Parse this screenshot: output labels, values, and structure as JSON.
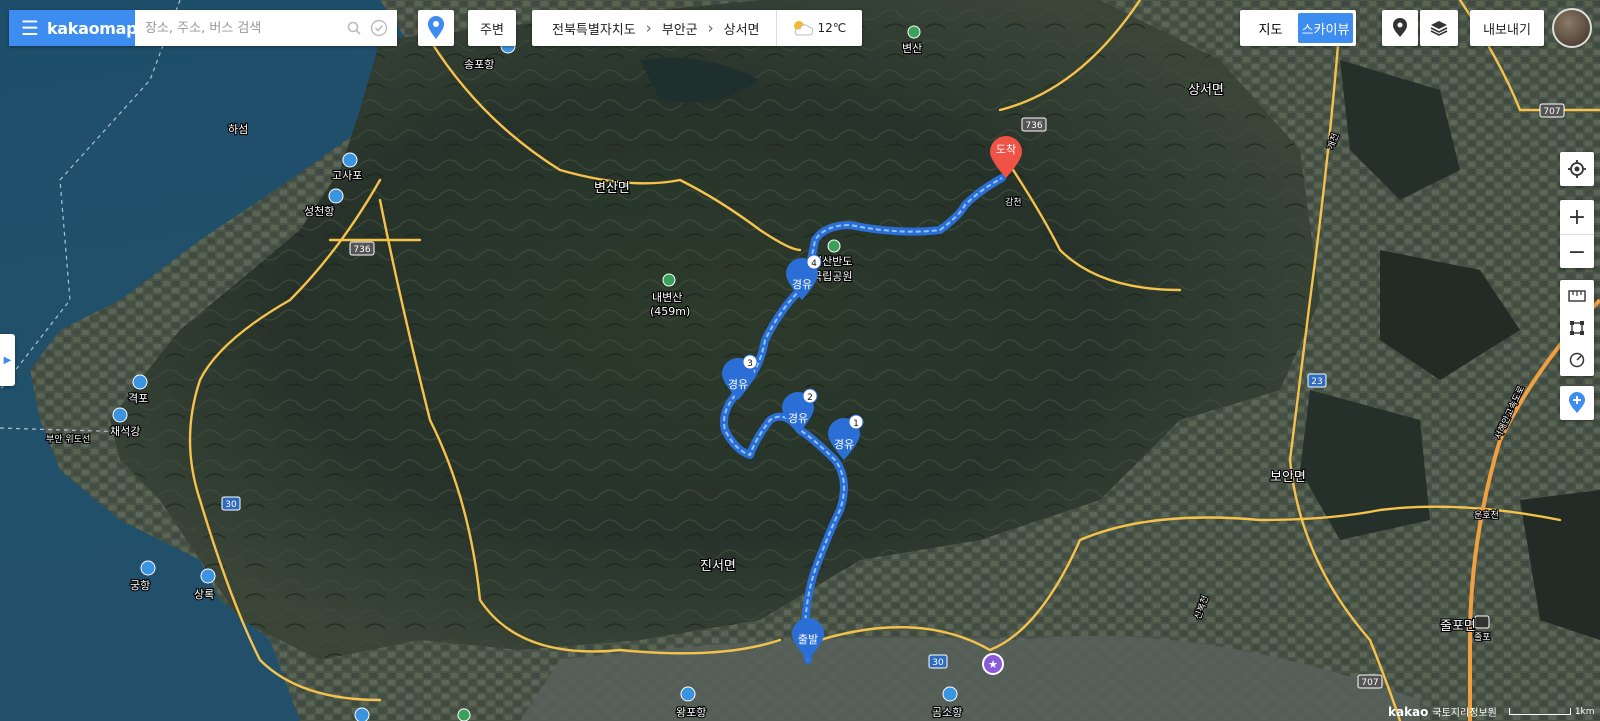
{
  "app": {
    "logo": "kakaomap"
  },
  "search": {
    "placeholder": "장소, 주소, 버스 검색"
  },
  "nearby_label": "주변",
  "breadcrumb": [
    "전북특별자치도",
    "부안군",
    "상서면"
  ],
  "weather": {
    "temp": "12℃",
    "icon": "partly-cloudy-icon"
  },
  "map_type": {
    "map_label": "지도",
    "skyview_label": "스카이뷰",
    "active": "스카이뷰"
  },
  "export_label": "내보내기",
  "route": {
    "color": "#3d8cf0",
    "start_label": "출발",
    "end_label": "도착",
    "waypoints": [
      {
        "label": "경유",
        "number": "1"
      },
      {
        "label": "경유",
        "number": "2"
      },
      {
        "label": "경유",
        "number": "3"
      },
      {
        "label": "경유",
        "number": "4"
      }
    ]
  },
  "places": {
    "songpo": "송포항",
    "haseom": "하섬",
    "gosapo": "고사포",
    "seongcheon": "성천항",
    "byeonsan_myeon": "변산면",
    "byeonsan": "변산",
    "naebyeonsan": "내변산",
    "naebyeonsan_height": "(459m)",
    "park": "변산반도",
    "park2": "국립공원",
    "sangseo": "상서면",
    "gyeongpo": "격포",
    "chaeseokgang": "채석강",
    "buan_wido": "부안 위도선",
    "gunghang": "궁항",
    "sangnok": "상록",
    "jinseo": "진서면",
    "wangpo": "왕포항",
    "gomso": "곰소항",
    "boan": "보안면",
    "julpo_myeon": "줄포면",
    "julpo_ic": "줄포",
    "unhocheon": "운호천",
    "sinbokcheon": "신복천",
    "gaecheon": "개천",
    "seohaean": "서해안고속도로",
    "gamcheon": "감천"
  },
  "roads": [
    "736",
    "736",
    "707",
    "707",
    "23",
    "30",
    "30"
  ],
  "credit": {
    "brand": "kakao",
    "source": "국토지리정보원",
    "scale": "1km"
  },
  "colors": {
    "accent": "#3d8cf0",
    "end_marker": "#f05246",
    "road": "#f5c34b",
    "highway": "#f0a040"
  }
}
